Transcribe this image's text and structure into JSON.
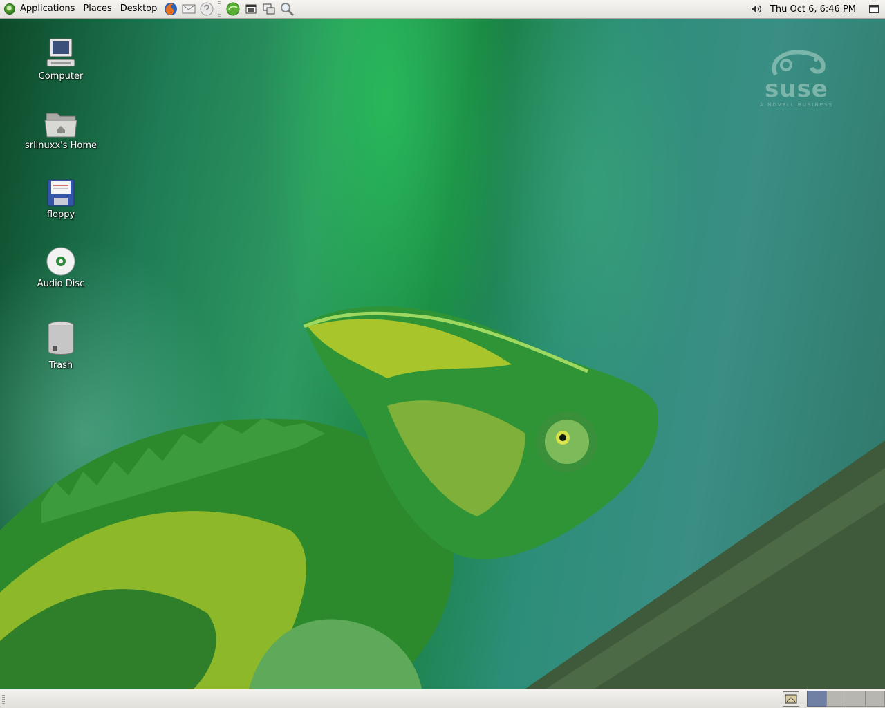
{
  "top_panel": {
    "menus": [
      "Applications",
      "Places",
      "Desktop"
    ],
    "launchers": [
      "firefox-icon",
      "mail-icon",
      "help-icon",
      "gecko-icon",
      "terminal-icon",
      "window-icon",
      "search-icon"
    ],
    "clock": "Thu Oct  6,  6:46 PM"
  },
  "desktop": {
    "icons": [
      {
        "label": "Computer",
        "icon": "computer-icon"
      },
      {
        "label": "srlinuxx's Home",
        "icon": "home-folder-icon"
      },
      {
        "label": "floppy",
        "icon": "floppy-icon"
      },
      {
        "label": "Audio Disc",
        "icon": "cd-icon"
      },
      {
        "label": "Trash",
        "icon": "trash-icon"
      }
    ],
    "logo": {
      "word": "suse",
      "tagline": "A NOVELL BUSINESS"
    }
  },
  "bottom_panel": {
    "workspaces": 4,
    "active_workspace": 1
  },
  "colors": {
    "panel": "#e9e7e2",
    "workspace_active": "#6f80a4",
    "wallpaper_green": "#1f7c55"
  }
}
